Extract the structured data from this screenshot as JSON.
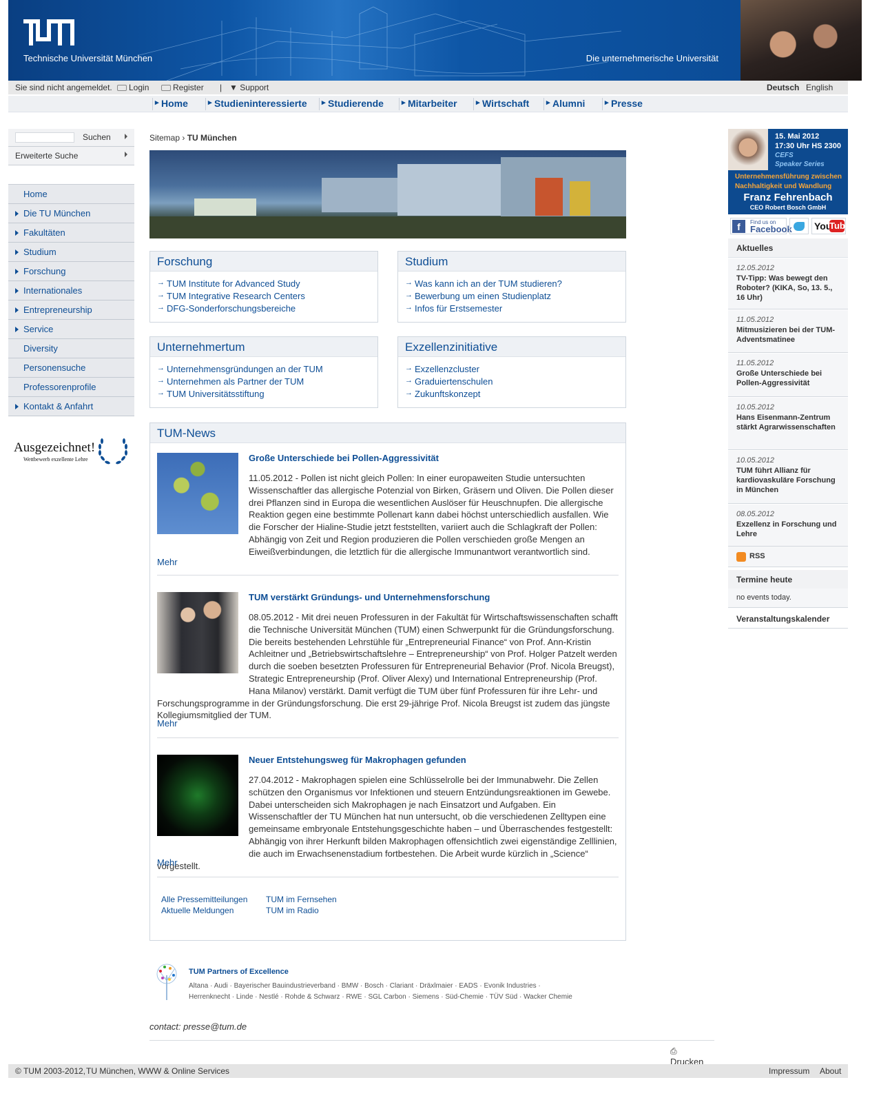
{
  "header": {
    "university_name": "Technische Universität München",
    "slogan": "Die unternehmerische Universität"
  },
  "metabar": {
    "login_status": "Sie sind nicht angemeldet.",
    "login": "Login",
    "register": "Register",
    "support": "Support",
    "lang_de": "Deutsch",
    "lang_en": "English"
  },
  "mainnav": [
    "Home",
    "Studieninteressierte",
    "Studierende",
    "Mitarbeiter",
    "Wirtschaft",
    "Alumni",
    "Presse"
  ],
  "search": {
    "label": "Suchen",
    "advanced": "Erweiterte Suche"
  },
  "sidebar": [
    {
      "label": "Home",
      "arrow": false
    },
    {
      "label": "Die TU München",
      "arrow": true
    },
    {
      "label": "Fakultäten",
      "arrow": true
    },
    {
      "label": "Studium",
      "arrow": true
    },
    {
      "label": "Forschung",
      "arrow": true
    },
    {
      "label": "Internationales",
      "arrow": true
    },
    {
      "label": "Entrepreneurship",
      "arrow": true
    },
    {
      "label": "Service",
      "arrow": true
    },
    {
      "label": "Diversity",
      "arrow": false
    },
    {
      "label": "Personensuche",
      "arrow": false
    },
    {
      "label": "Professorenprofile",
      "arrow": false
    },
    {
      "label": "Kontakt & Anfahrt",
      "arrow": true
    }
  ],
  "award": {
    "title": "Ausgezeichnet!",
    "subtitle": "Wettbewerb exzellente Lehre"
  },
  "breadcrumb": {
    "root": "Sitemap",
    "sep": "›",
    "current": "TU München"
  },
  "boxes": [
    {
      "title": "Forschung",
      "links": [
        "TUM Institute for Advanced Study",
        "TUM Integrative Research Centers",
        "DFG-Sonderforschungsbereiche"
      ]
    },
    {
      "title": "Studium",
      "links": [
        "Was kann ich an der TUM studieren?",
        "Bewerbung um einen Studienplatz",
        "Infos für Erstsemester"
      ]
    },
    {
      "title": "Unternehmertum",
      "links": [
        "Unternehmensgründungen an der TUM",
        "Unternehmen als Partner der TUM",
        "TUM Universitätsstiftung"
      ]
    },
    {
      "title": "Exzellenzinitiative",
      "links": [
        "Exzellenzcluster",
        "Graduiertenschulen",
        "Zukunftskonzept"
      ]
    }
  ],
  "news": {
    "title": "TUM-News",
    "more_label": "Mehr",
    "articles": [
      {
        "title": "Große Unterschiede bei Pollen-Aggressivität",
        "text": "11.05.2012 - Pollen ist nicht gleich Pollen: In einer europaweiten Studie untersuchten Wissenschaftler das allergische Potenzial von Birken, Gräsern und Oliven. Die Pollen dieser drei Pflanzen sind in Europa die wesentlichen Auslöser für Heuschnupfen. Die allergische Reaktion gegen eine bestimmte Pollenart kann dabei höchst unterschiedlich ausfallen. Wie die Forscher der Hialine-Studie jetzt feststellten, variiert auch die Schlagkraft der Pollen: Abhängig von Zeit und Region produzieren die Pollen verschieden große Mengen an Eiweißverbindungen, die letztlich für die allergische Immunantwort verantwortlich sind."
      },
      {
        "title": "TUM verstärkt Gründungs- und Unternehmensforschung",
        "text": "08.05.2012 - Mit drei neuen Professuren in der Fakultät für Wirtschaftswissenschaften schafft die Technische Universität München (TUM) einen Schwerpunkt für die Gründungsforschung. Die bereits bestehenden Lehrstühle für „Entrepreneurial Finance“ von Prof. Ann-Kristin Achleitner und „Betriebswirtschaftslehre – Entrepreneurship“ von Prof. Holger Patzelt werden durch die soeben besetzten Professuren für Entrepreneurial Behavior (Prof. Nicola Breugst), Strategic Entrepreneurship (Prof. Oliver Alexy) und International Entrepreneurship (Prof. Hana Milanov) verstärkt. Damit verfügt die TUM über fünf Professuren für ihre Lehr- und Forschungsprogramme in der Gründungsforschung. Die erst 29-jährige Prof. Nicola Breugst ist zudem das jüngste Kollegiumsmitglied der TUM."
      },
      {
        "title": "Neuer Entstehungsweg für Makrophagen gefunden",
        "text": "27.04.2012 - Makrophagen spielen eine Schlüsselrolle bei der Immunabwehr. Die Zellen schützen den Organismus vor Infektionen und steuern Entzündungsreaktionen im Gewebe. Dabei unterscheiden sich Makrophagen je nach Einsatzort und Aufgaben. Ein Wissenschaftler der TU München hat nun untersucht, ob die verschiedenen Zelltypen eine gemeinsame embryonale Entstehungsgeschichte haben – und Überraschendes festgestellt: Abhängig von ihrer Herkunft bilden Makrophagen offensichtlich zwei eigenständige Zelllinien, die auch im Erwachsenenstadium fortbestehen. Die Arbeit wurde kürzlich in „Science“ vorgestellt."
      }
    ],
    "links": [
      "Alle Pressemitteilungen",
      "Aktuelle Meldungen",
      "TUM im Fernsehen",
      "TUM im Radio"
    ]
  },
  "partners": {
    "title": "TUM Partners of Excellence",
    "line1": "Altana · Audi · Bayerischer Bauindustrieverband · BMW · Bosch · Clariant · Dräxlmaier · EADS · Evonik Industries ·",
    "line2": "Herrenknecht · Linde · Nestlé · Rohde & Schwarz · RWE · SGL Carbon · Siemens · Süd-Chemie · TÜV Süd · Wacker Chemie"
  },
  "contact": "contact: presse@tum.de",
  "print": "Drucken",
  "banner": {
    "date": "15. Mai 2012",
    "time": "17:30 Uhr HS 2300",
    "series1": "CEFS",
    "series2": "Speaker Series",
    "topic1": "Unternehmensführung zwischen",
    "topic2": "Nachhaltigkeit und Wandlung",
    "name": "Franz Fehrenbach",
    "role": "CEO Robert Bosch GmbH"
  },
  "social": {
    "fb_small": "Find us on",
    "fb_big": "Facebook",
    "yt_you": "You",
    "yt_tube": "Tube"
  },
  "aktuelles": {
    "title": "Aktuelles",
    "items": [
      {
        "date": "12.05.2012",
        "text": "TV-Tipp: Was bewegt den Roboter? (KIKA, So, 13. 5., 16 Uhr)"
      },
      {
        "date": "11.05.2012",
        "text": "Mitmusizieren bei der TUM-Adventsmatinee"
      },
      {
        "date": "11.05.2012",
        "text": "Große Unterschiede bei Pollen-Aggressivität"
      },
      {
        "date": "10.05.2012",
        "text": "Hans Eisenmann-Zentrum stärkt Agrarwissenschaften"
      },
      {
        "date": "10.05.2012",
        "text": "TUM führt Allianz für kardiovaskuläre Forschung in München"
      },
      {
        "date": "08.05.2012",
        "text": "Exzellenz in Forschung und Lehre"
      }
    ],
    "rss": "RSS"
  },
  "termine": {
    "title": "Termine heute",
    "no_events": "no events today.",
    "calendar": "Veranstaltungskalender"
  },
  "footer": {
    "copyright": "© TUM 2003-2012,",
    "org": "TU München, WWW & Online Services",
    "impressum": "Impressum",
    "about": "About"
  }
}
